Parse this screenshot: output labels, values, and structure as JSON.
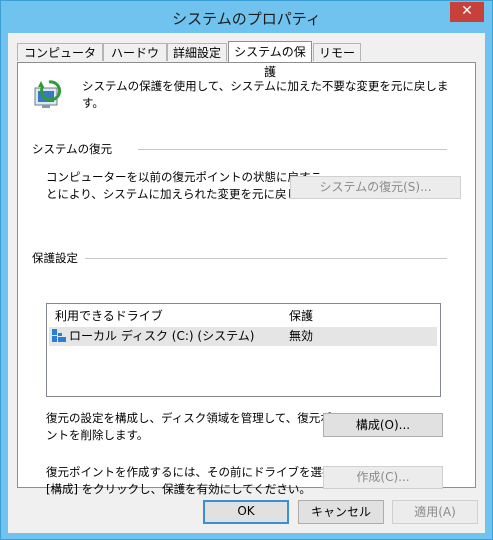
{
  "window": {
    "title": "システムのプロパティ",
    "close_glyph": "✕"
  },
  "tabs": [
    {
      "label": "コンピューター名"
    },
    {
      "label": "ハードウェア"
    },
    {
      "label": "詳細設定"
    },
    {
      "label": "システムの保護"
    },
    {
      "label": "リモート"
    }
  ],
  "intro": {
    "text": "システムの保護を使用して、システムに加えた不要な変更を元に戻します。",
    "icon": "system-protection-icon"
  },
  "restore_section": {
    "heading": "システムの復元",
    "line1": "コンピューターを以前の復元ポイントの状態に戻すこ",
    "line2": "とにより、システムに加えられた変更を元に戻します。",
    "button_label": "システムの復元(S)..."
  },
  "protection_section": {
    "heading": "保護設定",
    "columns": {
      "drive": "利用できるドライブ",
      "protection": "保護"
    },
    "rows": [
      {
        "drive": "ローカル ディスク (C:) (システム)",
        "protection": "無効",
        "icon": "windows-drive-icon"
      }
    ],
    "configure_line1": "復元の設定を構成し、ディスク領域を管理して、復元ポイ",
    "configure_line2": "ントを削除します。",
    "configure_button": "構成(O)...",
    "create_line1": "復元ポイントを作成するには、その前にドライブを選択して",
    "create_line2": "[構成] をクリックし、保護を有効にしてください。",
    "create_button": "作成(C)..."
  },
  "footer": {
    "ok": "OK",
    "cancel": "キャンセル",
    "apply": "適用(A)"
  },
  "colors": {
    "frame": "#6fc3ee",
    "close": "#c7413a",
    "default_border": "#3c8fd6"
  }
}
